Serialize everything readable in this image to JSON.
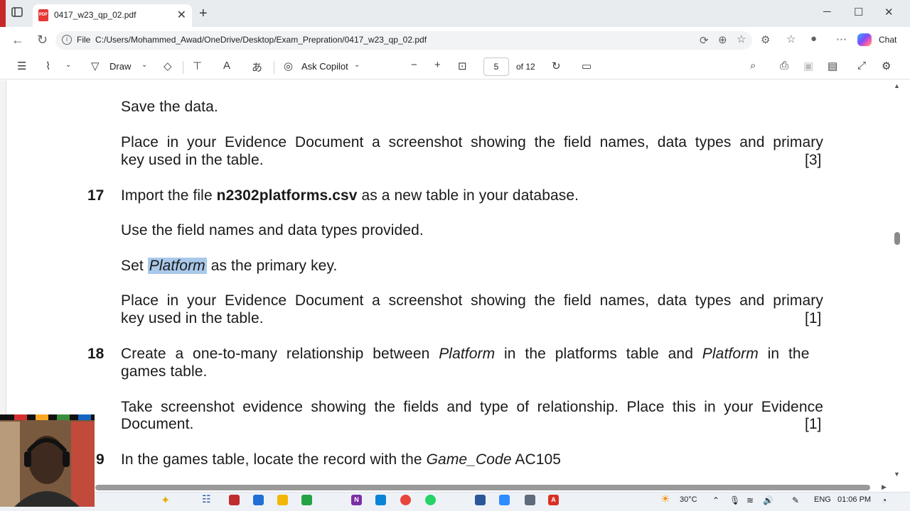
{
  "browser": {
    "tab_title": "0417_w23_qp_02.pdf",
    "tab_icon_text": "PDF",
    "url_scheme": "File",
    "url": "C:/Users/Mohammed_Awad/OneDrive/Desktop/Exam_Prepration/0417_w23_qp_02.pdf",
    "chat_label": "Chat"
  },
  "pdf_toolbar": {
    "draw_label": "Draw",
    "ask_copilot_label": "Ask Copilot",
    "current_page": "5",
    "page_total": "of 12"
  },
  "document": {
    "line_save": "Save the data.",
    "q16_evidence_line1": "Place in your Evidence Document a screenshot showing the field names, data types and primary",
    "q16_evidence_line2": "key used in the table.",
    "q16_marks": "[3]",
    "q17_number": "17",
    "q17_import_prefix": "Import the file ",
    "q17_filename": "n2302platforms.csv",
    "q17_import_suffix": " as a new table in your database.",
    "q17_use_fields": "Use the field names and data types provided.",
    "q17_set_prefix": "Set ",
    "q17_set_field": "Platform",
    "q17_set_suffix": " as the primary key.",
    "q17_evidence_line1": "Place in your Evidence Document a screenshot showing the field names, data types and primary",
    "q17_evidence_line2": "key used in the table.",
    "q17_marks": "[1]",
    "q18_number": "18",
    "q18_line1_a": "Create a one-to-many relationship between ",
    "q18_line1_field1": "Platform",
    "q18_line1_b": " in the platforms table and ",
    "q18_line1_field2": "Platform",
    "q18_line1_c": " in the",
    "q18_line2": "games table.",
    "q18_take_line1": "Take screenshot evidence showing the fields and type of relationship. Place this in your Evidence",
    "q18_take_line2": "Document.",
    "q18_marks": "[1]",
    "q19_number": "9",
    "q19_prefix": "In the games table, locate the record with the ",
    "q19_field": "Game_Code",
    "q19_suffix": " AC105"
  },
  "taskbar": {
    "weather": "30°C",
    "language": "ENG",
    "clock": "01:06 PM"
  },
  "colors": {
    "selection_highlight": "#a9c8ea",
    "copilot_gradient": "#7b4dff",
    "pdf_red": "#e53935"
  }
}
